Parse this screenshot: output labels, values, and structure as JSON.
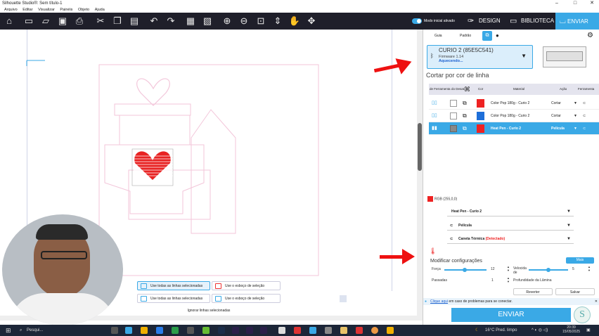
{
  "window": {
    "title": "Silhouette Studio®: Sem título-1",
    "minimize": "–",
    "maximize": "□",
    "close": "✕"
  },
  "menu": [
    "Arquivo",
    "Editar",
    "Visualizar",
    "Painéis",
    "Objeto",
    "Ajuda"
  ],
  "toolbar": {
    "mode_label": "Modo inicial ativado",
    "design": "DESIGN",
    "biblioteca": "BIBLIOTECA",
    "enviar": "ENVIAR"
  },
  "popup": {
    "use_all_selected": "Use todas as linhas selecionadas",
    "use_sketch_selection": "Use o esboço de seleção",
    "use_all_selected_2": "Use todas as linhas selecionadas",
    "use_sketch_selection_2": "Use o esboço de seleção",
    "ignore_selected": "Ignorar linhas selecionadas"
  },
  "panel": {
    "tabs": [
      "Guia",
      "Padrão"
    ],
    "device": {
      "name": "CURIO 2 (85E5C541)",
      "firmware": "Firmware 1.14",
      "status": "Aquecendo..."
    },
    "section_title": "Cortar por cor de linha",
    "table": {
      "headers": [
        "de Ferramenta",
        "do Desati",
        "",
        "Cor",
        "Material",
        "Ação",
        "Ferramenta"
      ],
      "rows": [
        {
          "material": "Color Pop 180g - Curio 2",
          "action": "Cortar",
          "color": "#e82323",
          "selected": false
        },
        {
          "material": "Color Pop 180g - Curio 2",
          "action": "Cortar",
          "color": "#e82323",
          "selected": false
        },
        {
          "material": "Heat Pen - Curio 2",
          "action": "Película",
          "color": "#e82323",
          "selected": true
        }
      ]
    },
    "rgb_label": "RGB (255,0,0)",
    "material_select": "Heat Pen - Curio 2",
    "action_select": "Película",
    "tool_select": "Caneta Térmica",
    "tool_status": "(Detectado)",
    "modify_label": "Modificar configurações",
    "mais_label": "Mais",
    "settings": {
      "forca_label": "Força",
      "forca_value": "12",
      "velocidade_label": "Velocida de",
      "velocidade_value": "5",
      "passadas_label": "Passadas",
      "passadas_value": "1",
      "profundidade_label": "Profundidade da Lâmina"
    },
    "reverter": "Reverter",
    "salvar": "Salvar",
    "notice_link": "Clique aqui",
    "notice_text": "em caso de problemas para se conectar.",
    "send_button": "ENVIAR",
    "forca_fraction": 0.48,
    "velocidade_fraction": 0.5
  },
  "taskbar": {
    "search": "Pesqui...",
    "weather": "16°C  Pred. limpo",
    "time": "20:39",
    "date": "15/05/2025"
  },
  "colors": {
    "accent": "#3aa9e6",
    "dark": "#1f1f2a",
    "red": "#e82323",
    "pink_outline": "#f5cfe0"
  }
}
